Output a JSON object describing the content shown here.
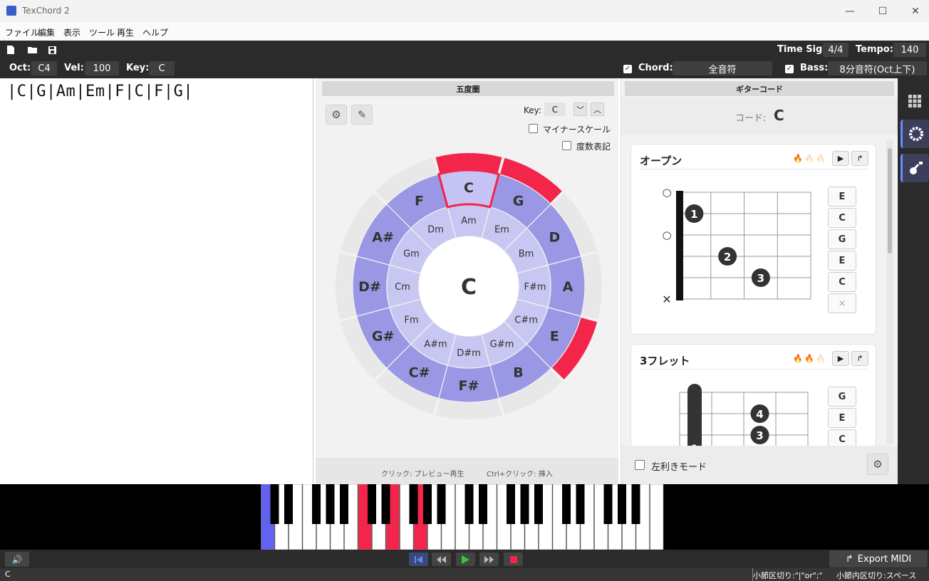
{
  "window": {
    "title": "TexChord 2",
    "minimize": "—",
    "maximize": "☐",
    "close": "✕"
  },
  "menu": [
    "ファイル",
    "編集",
    "表示",
    "ツール",
    "再生",
    "ヘルプ"
  ],
  "toolbar": {
    "time_sig_label": "Time Sig:",
    "time_sig": "4/4",
    "tempo_label": "Tempo:",
    "tempo": "140",
    "oct_label": "Oct:",
    "oct": "C4",
    "vel_label": "Vel:",
    "vel": "100",
    "key_label": "Key:",
    "key": "C",
    "chord_label": "Chord:",
    "chord_mode": "全音符",
    "bass_label": "Bass:",
    "bass_mode": "8分音符(Oct上下)",
    "check_mark": "✓"
  },
  "editor": {
    "text": "|C|G|Am|Em|F|C|F|G|"
  },
  "circle": {
    "header": "五度圏",
    "key_label": "Key:",
    "key": "C",
    "minor_scale_label": "マイナースケール",
    "degree_label": "度数表記",
    "center": "C",
    "major": [
      "C",
      "G",
      "D",
      "A",
      "E",
      "B",
      "F#",
      "C#",
      "G#",
      "D#",
      "A#",
      "F"
    ],
    "minor": [
      "Am",
      "Em",
      "Bm",
      "F#m",
      "C#m",
      "G#m",
      "D#m",
      "A#m",
      "Fm",
      "Cm",
      "Gm",
      "Dm"
    ],
    "selected_index": 0,
    "highlight_outer": [
      0,
      1,
      4
    ],
    "footer_click": "クリック: プレビュー再生",
    "footer_ctrl": "Ctrl+クリック: 挿入",
    "colors": {
      "ring_major": "#9a98e4",
      "ring_minor": "#c8c7f2",
      "active": "#f4254a",
      "outer": "#e8e8e8"
    }
  },
  "guitar": {
    "header": "ギターコード",
    "chord_label": "コード:",
    "chord": "C",
    "open": {
      "title": "オープン",
      "difficulty": [
        "🔥",
        "🔥",
        "🔥"
      ],
      "notes": [
        "E",
        "C",
        "G",
        "E",
        "C",
        "×"
      ],
      "fret_numbers": [
        "1",
        "2",
        "3",
        "4"
      ],
      "fingers": [
        "1",
        "2",
        "3"
      ],
      "open_mark": "○",
      "mute_mark": "✕"
    },
    "fret3": {
      "title": "3フレット",
      "difficulty": [
        "🔥",
        "🔥",
        "🔥"
      ],
      "notes": [
        "G",
        "E",
        "C"
      ],
      "fingers": [
        "4",
        "3",
        "1"
      ]
    },
    "left_hand_label": "左利きモード"
  },
  "piano": {
    "highlight_white_blue": [
      0
    ],
    "highlight_white_red": [
      7,
      9,
      11
    ]
  },
  "transport": {
    "export_label": "Export MIDI",
    "volume_icon": "🔊"
  },
  "status": {
    "left": "C",
    "right1": "小節区切り:\"|\"or\";\"",
    "right2": "小節内区切り:スペース"
  }
}
